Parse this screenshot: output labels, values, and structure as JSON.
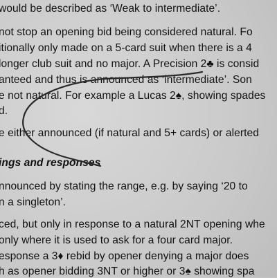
{
  "document": {
    "lines": [
      "would be described as ‘Weak to intermediate’.",
      "not stop an opening bid being considered natural. Fo",
      "itionally only made on a 5-card suit when there is a 4",
      "longer club suit and no major. A Precision 2♣ is consid",
      "anteed and thus is announced as ‘intermediate’. Son",
      "e not natural. For example a Lucas 2♠, showing spades",
      "d.",
      "e either announced (if natural and 5+ cards) or alerted",
      "ings and responses",
      "nnounced by stating the range, e.g. by saying ‘20 to",
      "n a singleton’.",
      "ced, but only in response to a natural 2NT opening whe",
      "only where it is used to ask for a four card major.",
      "esponse a 3♦ rebid by opener denying a major does",
      "h as opener bidding 3NT or higher or 3♠ showing spa"
    ]
  }
}
